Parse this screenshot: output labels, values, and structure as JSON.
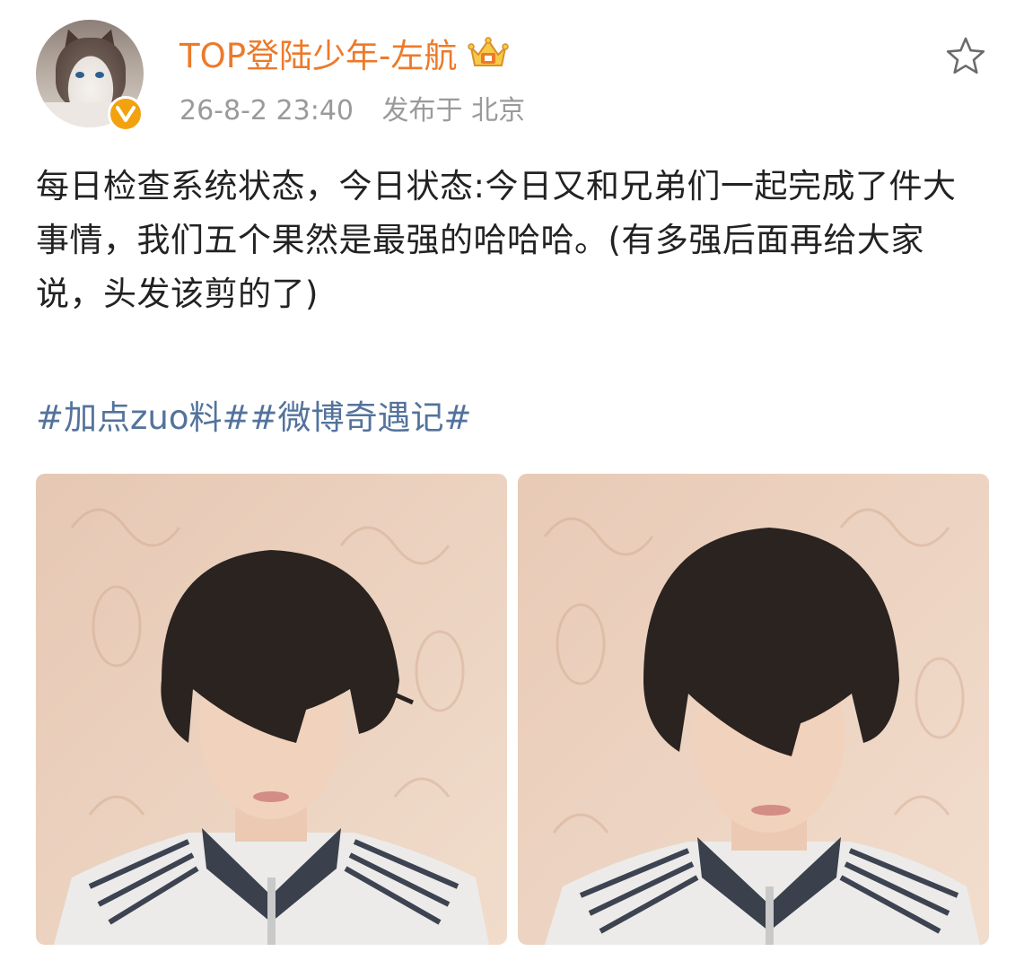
{
  "post": {
    "author": {
      "name": "TOP登陆少年-左航",
      "avatar_icon": "cat-avatar",
      "verified_icon": "verified-badge-icon",
      "member_icon": "crown-icon"
    },
    "timestamp": "26-8-2 23:40",
    "location": "发布于 北京",
    "text": "每日检查系统状态，今日状态:今日又和兄弟们一起完成了件大事情，我们五个果然是最强的哈哈哈。(有多强后面再给大家说，头发该剪的了)",
    "topics": [
      "#加点zuo料#",
      "#微博奇遇记#"
    ],
    "favorite_icon": "star-outline-icon",
    "images": [
      {
        "name": "photo-1",
        "description_icon": "selfie-photo"
      },
      {
        "name": "photo-2",
        "description_icon": "selfie-photo"
      }
    ]
  },
  "colors": {
    "username": "#ec7a2a",
    "meta": "#9a9a9a",
    "body_text": "#222222",
    "topic_link": "#53739c",
    "verified_badge": "#f3a20f"
  }
}
